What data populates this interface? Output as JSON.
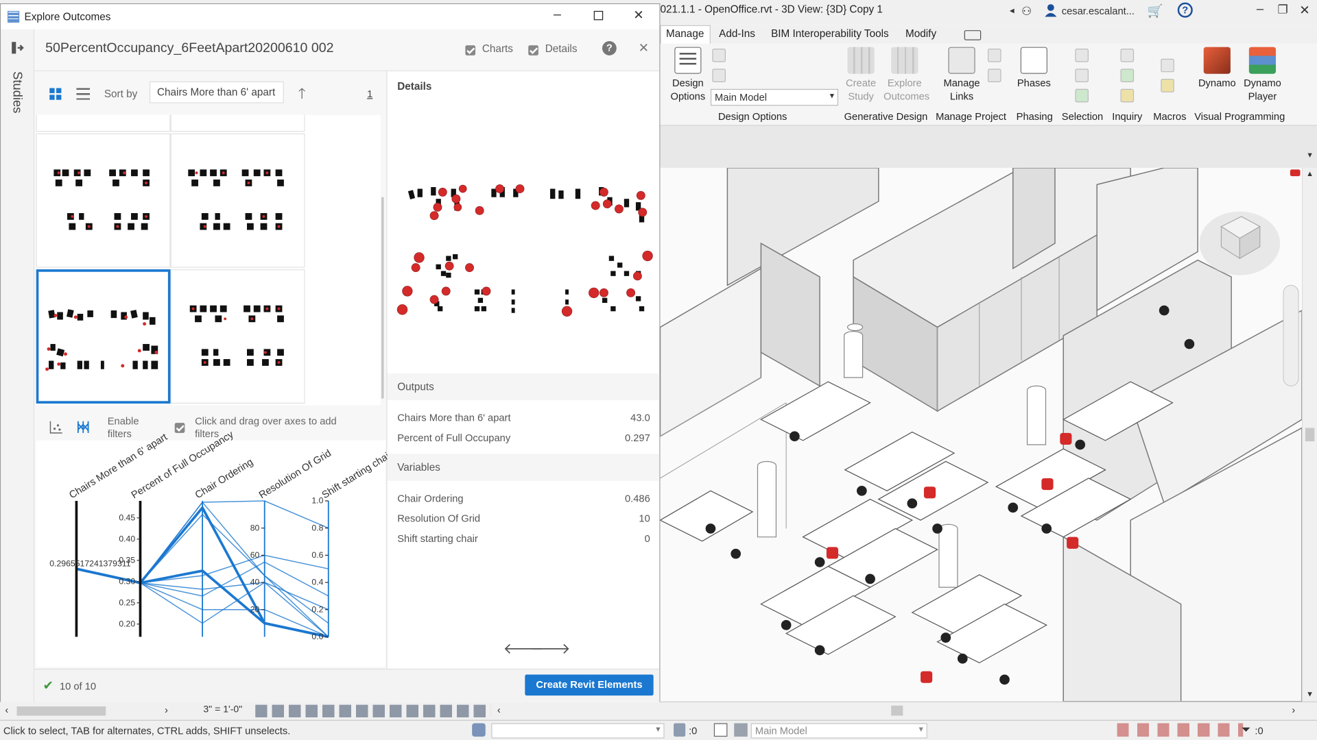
{
  "revit": {
    "title": "021.1.1 - OpenOffice.rvt - 3D View: {3D} Copy 1",
    "user": "cesar.escalant...",
    "tabs": [
      "Manage",
      "Add-Ins",
      "BIM Interoperability Tools",
      "Modify"
    ],
    "ribbon": {
      "design_options": "Design Options",
      "main_model_select": "Main Model",
      "create_study": "Create Study",
      "explore_outcomes": "Explore Outcomes",
      "manage_links": "Manage Links",
      "phases": "Phases",
      "dynamo": "Dynamo",
      "dynamo_player": "Dynamo Player",
      "groups": [
        "Design Options",
        "Generative Design",
        "Manage Project",
        "Phasing",
        "Selection",
        "Inquiry",
        "Macros",
        "Visual Programming"
      ]
    },
    "scale": "3\" = 1'-0\"",
    "status_text": "Click to select, TAB for alternates, CTRL adds, SHIFT unselects.",
    "status_model": "Main Model",
    "status_zero1": ":0",
    "status_zero2": ":0",
    "colors": {
      "chair_red": "#d42a2a",
      "ribbon_bg": "#f5f5f5"
    }
  },
  "dialog": {
    "title": "Explore Outcomes",
    "side_label": "Studies",
    "study_name": "50PercentOccupancy_6FeetApart20200610 002",
    "charts_label": "Charts",
    "details_label": "Details",
    "sort_by_label": "Sort by",
    "sort_value": "Chairs More than 6' apart",
    "page_number": "1",
    "enable_filters": "Enable filters",
    "click_drag_hint": "Click and drag over axes to add filters",
    "result_count": "10 of 10",
    "create_button": "Create Revit Elements",
    "accent": "#1b78d0"
  },
  "chart_data": {
    "type": "parallel-coordinates",
    "axes": [
      {
        "label": "Chairs More than 6' apart",
        "ticks": [],
        "marker": "0.2965517241379311"
      },
      {
        "label": "Percent of Full Occupancy",
        "ticks": [
          "0.20",
          "0.25",
          "0.30",
          "0.35",
          "0.40",
          "0.45"
        ],
        "range": [
          0.17,
          0.49
        ]
      },
      {
        "label": "Chair Ordering",
        "ticks": [],
        "range": [
          0,
          1
        ]
      },
      {
        "label": "Resolution Of Grid",
        "ticks": [
          "20",
          "40",
          "60",
          "80"
        ],
        "range": [
          0,
          100
        ]
      },
      {
        "label": "Shift starting chair",
        "ticks": [
          "0.0",
          "0.2",
          "0.4",
          "0.6",
          "0.8",
          "1.0"
        ],
        "range": [
          0,
          1
        ]
      }
    ],
    "lines": [
      {
        "values": [
          0.2965,
          0.297,
          0.486,
          10,
          0
        ],
        "highlight": true
      },
      {
        "values": [
          0.2965,
          0.297,
          0.95,
          10,
          0
        ],
        "highlight": true
      },
      {
        "values": [
          0.2965,
          0.297,
          0.99,
          100,
          0.8
        ]
      },
      {
        "values": [
          0.2965,
          0.297,
          0.99,
          45,
          0
        ]
      },
      {
        "values": [
          0.2965,
          0.297,
          0.35,
          40,
          0.2
        ]
      },
      {
        "values": [
          0.2965,
          0.297,
          0.1,
          40,
          0
        ]
      },
      {
        "values": [
          0.2965,
          0.297,
          0.3,
          55,
          0.3
        ]
      },
      {
        "values": [
          0.2965,
          0.297,
          0.9,
          45,
          0.1
        ]
      },
      {
        "values": [
          0.2965,
          0.297,
          0.45,
          60,
          0.5
        ]
      },
      {
        "values": [
          0.2965,
          0.297,
          0.2,
          20,
          0
        ]
      }
    ]
  },
  "details": {
    "header": "Details",
    "outputs_header": "Outputs",
    "outputs": [
      {
        "label": "Chairs More than 6' apart",
        "value": "43.0"
      },
      {
        "label": "Percent of Full Occupany",
        "value": "0.297"
      }
    ],
    "variables_header": "Variables",
    "variables": [
      {
        "label": "Chair Ordering",
        "value": "0.486"
      },
      {
        "label": "Resolution Of Grid",
        "value": "10"
      },
      {
        "label": "Shift starting chair",
        "value": "0"
      }
    ]
  }
}
